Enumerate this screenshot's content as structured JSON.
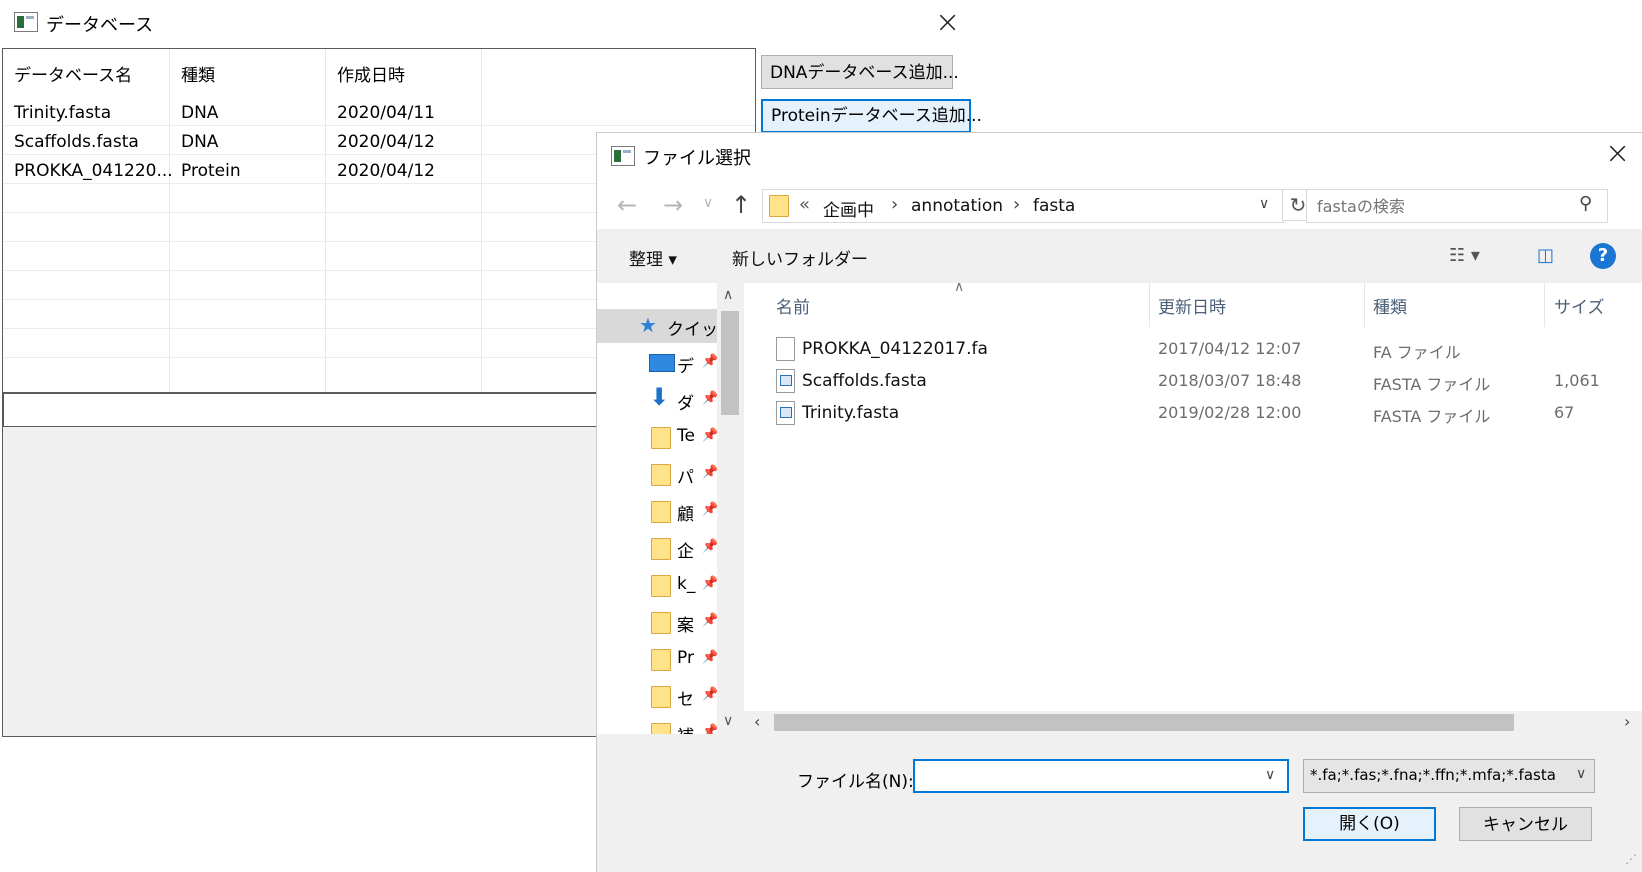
{
  "db_window": {
    "title": "データベース",
    "columns": [
      "データベース名",
      "種類",
      "作成日時"
    ],
    "rows": [
      {
        "name": "Trinity.fasta",
        "type": "DNA",
        "date": "2020/04/11"
      },
      {
        "name": "Scaffolds.fasta",
        "type": "DNA",
        "date": "2020/04/12"
      },
      {
        "name": "PROKKA_041220...",
        "type": "Protein",
        "date": "2020/04/12"
      }
    ],
    "add_dna_button": "DNAデータベース追加...",
    "add_protein_button": "Proteinデータベース追加..."
  },
  "file_dialog": {
    "title": "ファイル選択",
    "breadcrumb": {
      "overflow": "«",
      "items": [
        "企画中",
        "annotation",
        "fasta"
      ]
    },
    "search_placeholder": "fastaの検索",
    "toolbar": {
      "organize": "整理 ▾",
      "new_folder": "新しいフォルダー"
    },
    "nav_items": [
      {
        "label": "クイック",
        "icon": "star-icon"
      },
      {
        "label": "デ",
        "icon": "desktop-icon"
      },
      {
        "label": "ダ",
        "icon": "download-icon"
      },
      {
        "label": "Te",
        "icon": "folder-icon"
      },
      {
        "label": "パ",
        "icon": "folder-icon"
      },
      {
        "label": "顧",
        "icon": "folder-icon"
      },
      {
        "label": "企",
        "icon": "folder-icon"
      },
      {
        "label": "k_",
        "icon": "folder-icon"
      },
      {
        "label": "案",
        "icon": "folder-icon"
      },
      {
        "label": "Pr",
        "icon": "folder-icon"
      },
      {
        "label": "セ",
        "icon": "folder-icon"
      },
      {
        "label": "補",
        "icon": "folder-icon"
      }
    ],
    "list_columns": {
      "name": "名前",
      "modified": "更新日時",
      "type": "種類",
      "size": "サイズ"
    },
    "files": [
      {
        "name": "PROKKA_04122017.fa",
        "modified": "2017/04/12 12:07",
        "type": "FA ファイル",
        "size": "",
        "icon": "file-icon"
      },
      {
        "name": "Scaffolds.fasta",
        "modified": "2018/03/07 18:48",
        "type": "FASTA ファイル",
        "size": "1,061",
        "icon": "fasta-file-icon"
      },
      {
        "name": "Trinity.fasta",
        "modified": "2019/02/28 12:00",
        "type": "FASTA ファイル",
        "size": "67",
        "icon": "fasta-file-icon"
      }
    ],
    "filename_label": "ファイル名(N):",
    "filename_value": "",
    "filter_value": "*.fa;*.fas;*.fna;*.ffn;*.mfa;*.fasta",
    "open_button": "開く(O)",
    "cancel_button": "キャンセル"
  },
  "colors": {
    "accent": "#0078d7",
    "help": "#1a76d2",
    "folder": "#ffe28a"
  }
}
